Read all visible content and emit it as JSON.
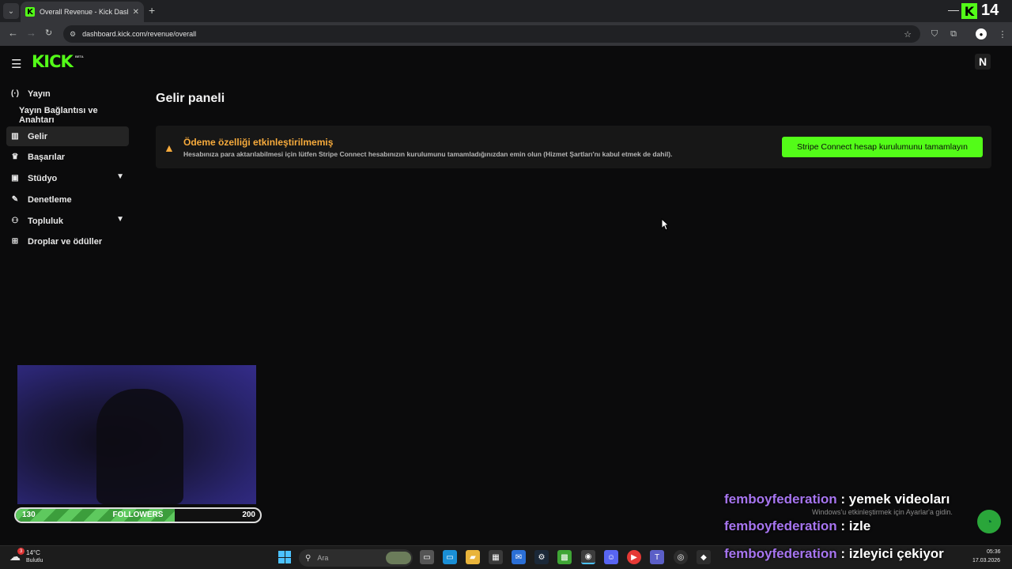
{
  "browser": {
    "tab_title": "Overall Revenue - Kick Dashboard",
    "tab_close": "✕",
    "new_tab": "+",
    "url": "dashboard.kick.com/revenue/overall",
    "minimize": "—"
  },
  "header": {
    "logo_text": "KICK",
    "logo_badge": "BETA",
    "user_initial": "N"
  },
  "sidebar": {
    "items": [
      {
        "label": "Yayın",
        "icon": "broadcast-icon"
      },
      {
        "label": "Yayın Bağlantısı ve Anahtarı",
        "icon": ""
      },
      {
        "label": "Gelir",
        "icon": "revenue-icon",
        "active": true
      },
      {
        "label": "Başarılar",
        "icon": "trophy-icon"
      },
      {
        "label": "Stüdyo",
        "icon": "studio-icon",
        "expandable": true
      },
      {
        "label": "Denetleme",
        "icon": "wrench-icon"
      },
      {
        "label": "Topluluk",
        "icon": "community-icon",
        "expandable": true
      },
      {
        "label": "Droplar ve ödüller",
        "icon": "gift-icon"
      }
    ]
  },
  "main": {
    "title": "Gelir paneli",
    "alert": {
      "title": "Ödeme özelliği etkinleştirilmemiş",
      "description": "Hesabınıza para aktarılabilmesi için lütfen Stripe Connect hesabınızın kurulumunu tamamladığınızdan emin olun (Hizmet Şartları'nı kabul etmek de dahil).",
      "button": "Stripe Connect hesap kurulumunu tamamlayın",
      "color": "#f7ab3c"
    }
  },
  "overlay": {
    "viewer_count": "14",
    "followers": {
      "current": "130",
      "label": "FOLLOWERS",
      "goal": "200",
      "progress": 0.65
    },
    "chat": [
      {
        "user": "femboyfederation",
        "sep": ":",
        "message": "yemek videoları"
      },
      {
        "user": "femboyfederation",
        "sep": ":",
        "message": "izle"
      },
      {
        "user": "femboyfederation",
        "sep": ":",
        "message": "izleyici çekiyor"
      }
    ],
    "activate_windows": "Windows'u etkinleştirmek için Ayarlar'a gidin."
  },
  "taskbar": {
    "weather_temp": "14°C",
    "weather_desc": "Bulutlu",
    "weather_badge": "3",
    "search_placeholder": "Ara",
    "time": "05:36",
    "date": "17.03.2026"
  },
  "colors": {
    "accent": "#53fc18",
    "chat_user": "#a775f0"
  }
}
